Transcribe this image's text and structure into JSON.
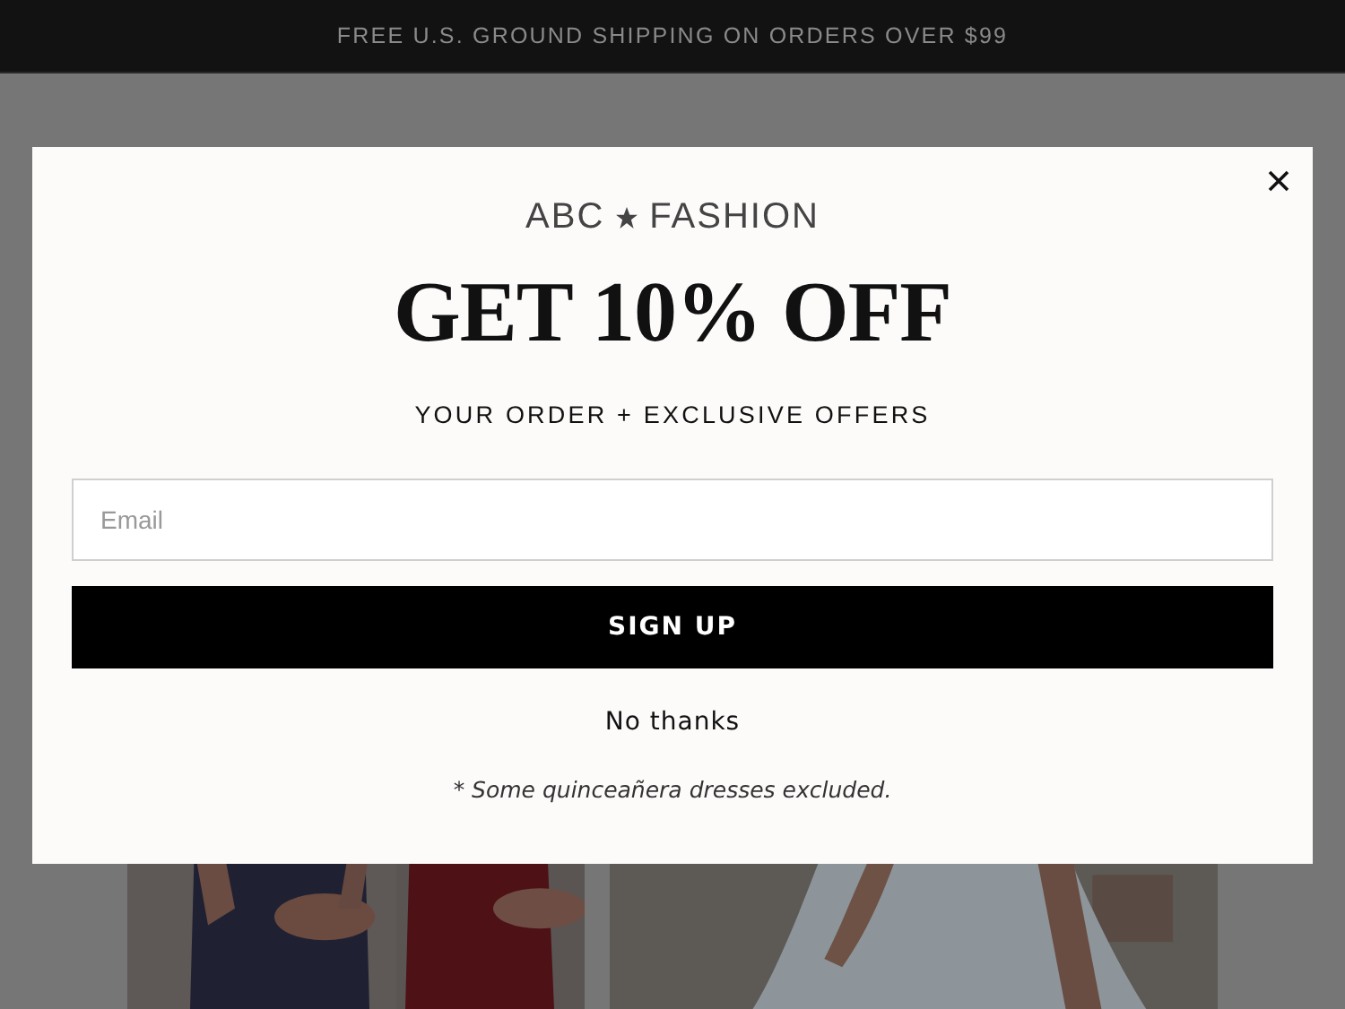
{
  "announcement": "FREE U.S. GROUND SHIPPING ON ORDERS OVER $99",
  "popup": {
    "logo": {
      "left": "ABC",
      "right": "FASHION"
    },
    "headline": "GET 10% OFF",
    "subheadline": "YOUR ORDER + EXCLUSIVE OFFERS",
    "email": {
      "placeholder": "Email"
    },
    "submit": "SIGN UP",
    "decline": "No thanks",
    "footnote": "* Some quinceañera dresses excluded."
  }
}
